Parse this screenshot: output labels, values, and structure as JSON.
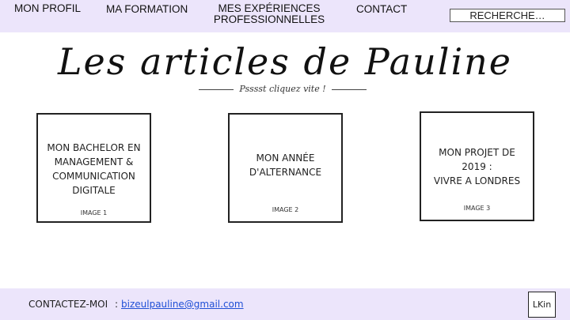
{
  "nav": {
    "items": [
      {
        "label": "MON PROFIL"
      },
      {
        "label": "MA FORMATION"
      },
      {
        "label": "MES EXPÉRIENCES\nPROFESSIONNELLES"
      },
      {
        "label": "CONTACT"
      }
    ],
    "search_placeholder": "RECHERCHE…"
  },
  "hero": {
    "title": "Les articles de Pauline",
    "subtitle": "Psssst cliquez vite !"
  },
  "cards": [
    {
      "title": "MON BACHELOR EN MANAGEMENT & COMMUNICATION DIGITALE",
      "image_label": "IMAGE 1"
    },
    {
      "title": "MON ANNÉE D'ALTERNANCE",
      "image_label": "IMAGE 2"
    },
    {
      "title": "MON PROJET DE 2019 :\nVIVRE A LONDRES",
      "image_label": "IMAGE 3"
    }
  ],
  "footer": {
    "contact_label": "CONTACTEZ-MOI",
    "separator": ":",
    "email": "bizeulpauline@gmail.com",
    "linkedin_label": "LKin"
  }
}
